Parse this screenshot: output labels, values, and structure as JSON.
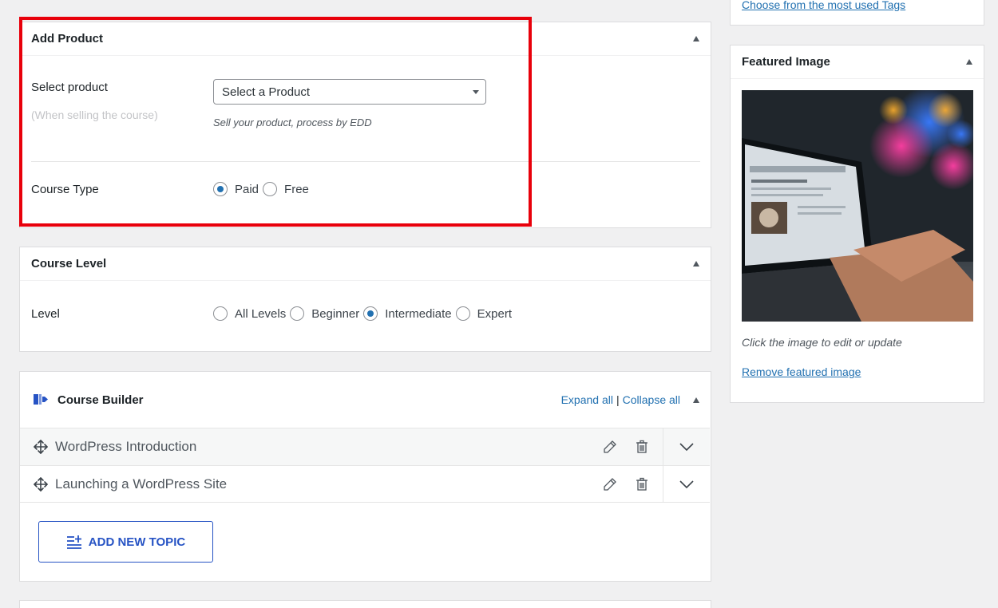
{
  "tags": {
    "choose_link": "Choose from the most used Tags"
  },
  "add_product": {
    "title": "Add Product",
    "select_label": "Select product",
    "select_sub": "(When selling the course)",
    "select_value": "Select a Product",
    "help": "Sell your product, process by EDD",
    "course_type_label": "Course Type",
    "course_type_options": [
      "Paid",
      "Free"
    ],
    "course_type_selected": "Paid"
  },
  "course_level": {
    "title": "Course Level",
    "level_label": "Level",
    "options": [
      "All Levels",
      "Beginner",
      "Intermediate",
      "Expert"
    ],
    "selected": "Intermediate"
  },
  "course_builder": {
    "title": "Course Builder",
    "expand_all": "Expand all",
    "separator": "|",
    "collapse_all": "Collapse all",
    "topics": [
      {
        "title": "WordPress Introduction"
      },
      {
        "title": "Launching a WordPress Site"
      }
    ],
    "add_topic_label": "ADD NEW TOPIC"
  },
  "featured_image": {
    "title": "Featured Image",
    "caption": "Click the image to edit or update",
    "remove_link": "Remove featured image"
  },
  "colors": {
    "accent": "#2271b1",
    "builder_blue": "#2653c4",
    "highlight": "#e8000b"
  }
}
